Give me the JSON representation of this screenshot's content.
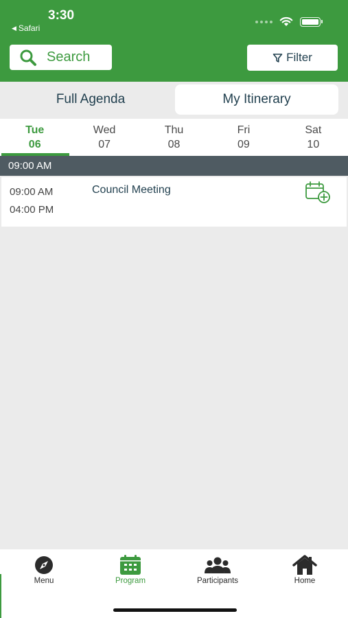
{
  "status_bar": {
    "time": "3:30",
    "back_app": "Safari"
  },
  "toolbar": {
    "search_label": "Search",
    "filter_label": "Filter"
  },
  "segments": {
    "full_agenda": "Full Agenda",
    "my_itinerary": "My Itinerary",
    "selected": "My Itinerary"
  },
  "days": [
    {
      "weekday": "Tue",
      "date": "06",
      "active": true
    },
    {
      "weekday": "Wed",
      "date": "07",
      "active": false
    },
    {
      "weekday": "Thu",
      "date": "08",
      "active": false
    },
    {
      "weekday": "Fri",
      "date": "09",
      "active": false
    },
    {
      "weekday": "Sat",
      "date": "10",
      "active": false
    }
  ],
  "schedule": {
    "time_header": "09:00 AM",
    "event": {
      "start": "09:00 AM",
      "end": "04:00 PM",
      "title": "Council Meeting"
    }
  },
  "bottom_nav": {
    "menu": "Menu",
    "program": "Program",
    "participants": "Participants",
    "home": "Home",
    "active": "Program"
  },
  "colors": {
    "brand_green": "#3d9a3f",
    "navy_text": "#1f3e4d",
    "time_header_bg": "#4f5b62",
    "content_bg": "#ebebeb"
  },
  "icons": {
    "search": "magnifier-icon",
    "filter": "funnel-icon",
    "add_to_calendar": "calendar-plus-icon",
    "menu": "compass-icon",
    "program": "calendar-icon",
    "participants": "people-icon",
    "home": "house-icon",
    "wifi": "wifi-icon",
    "battery": "battery-icon"
  }
}
